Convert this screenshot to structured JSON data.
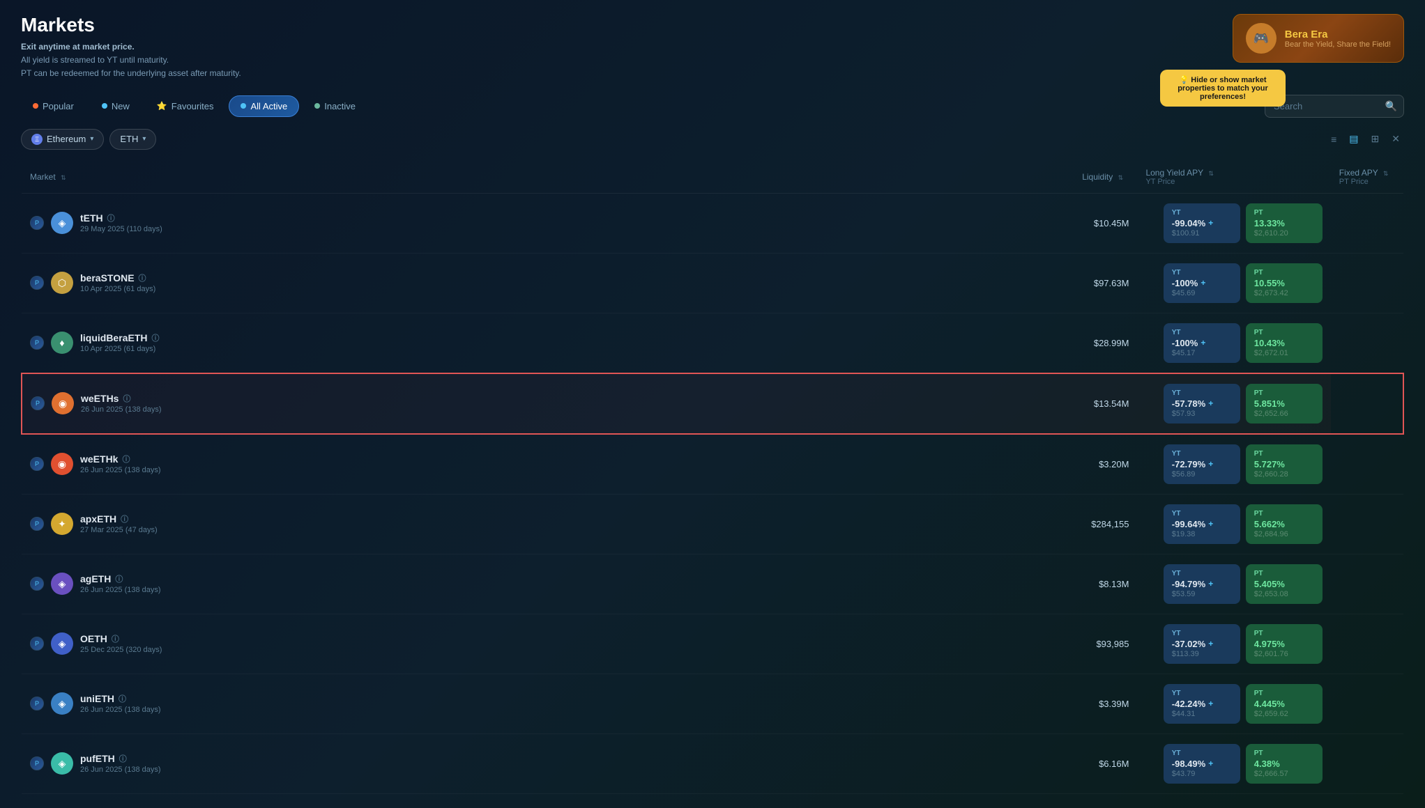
{
  "header": {
    "title": "Markets",
    "subtitle_line1": "Exit anytime at market price.",
    "subtitle_line2": "All yield is streamed to YT until maturity.",
    "subtitle_line3": "PT can be redeemed for the underlying asset after maturity."
  },
  "bera_banner": {
    "title": "Bera Era",
    "subtitle": "Bear the Yield, Share the Field!"
  },
  "tabs": [
    {
      "id": "popular",
      "label": "Popular",
      "active": false
    },
    {
      "id": "new",
      "label": "New",
      "active": false
    },
    {
      "id": "favourites",
      "label": "Favourites",
      "active": false
    },
    {
      "id": "allactive",
      "label": "All Active",
      "active": true
    },
    {
      "id": "inactive",
      "label": "Inactive",
      "active": false
    }
  ],
  "search": {
    "placeholder": "Search"
  },
  "tooltip": {
    "text": "Hide or show market properties to match your preferences!"
  },
  "filters": {
    "chain": "Ethereum",
    "asset": "ETH"
  },
  "table": {
    "columns": {
      "market": "Market",
      "liquidity": "Liquidity",
      "long_yield_apy": "Long Yield APY",
      "yt_price": "YT Price",
      "fixed_apy": "Fixed APY",
      "pt_price": "PT Price"
    },
    "rows": [
      {
        "id": "teth",
        "name": "tETH",
        "date": "29 May 2025 (110 days)",
        "liquidity": "$10.45M",
        "highlighted": false,
        "yt_value": "-99.04%",
        "yt_price": "$100.91",
        "pt_value": "13.33%",
        "pt_price": "$2,610.20",
        "icon_bg": "#4a90d9",
        "icon_text": "◈"
      },
      {
        "id": "berastone",
        "name": "beraSTONE",
        "date": "10 Apr 2025 (61 days)",
        "liquidity": "$97.63M",
        "highlighted": false,
        "yt_value": "-100%",
        "yt_price": "$45.69",
        "pt_value": "10.55%",
        "pt_price": "$2,673.42",
        "icon_bg": "#c4a040",
        "icon_text": "⬡"
      },
      {
        "id": "liquidberaETH",
        "name": "liquidBeraETH",
        "date": "10 Apr 2025 (61 days)",
        "liquidity": "$28.99M",
        "highlighted": false,
        "yt_value": "-100%",
        "yt_price": "$45.17",
        "pt_value": "10.43%",
        "pt_price": "$2,672.01",
        "icon_bg": "#3a9070",
        "icon_text": "♦"
      },
      {
        "id": "weETHs",
        "name": "weETHs",
        "date": "26 Jun 2025 (138 days)",
        "liquidity": "$13.54M",
        "highlighted": true,
        "yt_value": "-57.78%",
        "yt_price": "$57.93",
        "pt_value": "5.851%",
        "pt_price": "$2,652.66",
        "icon_bg": "#e07030",
        "icon_text": "◉"
      },
      {
        "id": "weETHk",
        "name": "weETHk",
        "date": "26 Jun 2025 (138 days)",
        "liquidity": "$3.20M",
        "highlighted": false,
        "yt_value": "-72.79%",
        "yt_price": "$56.89",
        "pt_value": "5.727%",
        "pt_price": "$2,660.28",
        "icon_bg": "#e05030",
        "icon_text": "◉"
      },
      {
        "id": "apxETH",
        "name": "apxETH",
        "date": "27 Mar 2025 (47 days)",
        "liquidity": "$284,155",
        "highlighted": false,
        "yt_value": "-99.64%",
        "yt_price": "$19.38",
        "pt_value": "5.662%",
        "pt_price": "$2,684.96",
        "icon_bg": "#d4a830",
        "icon_text": "✦"
      },
      {
        "id": "agETH",
        "name": "agETH",
        "date": "26 Jun 2025 (138 days)",
        "liquidity": "$8.13M",
        "highlighted": false,
        "yt_value": "-94.79%",
        "yt_price": "$53.59",
        "pt_value": "5.405%",
        "pt_price": "$2,653.08",
        "icon_bg": "#6a50c0",
        "icon_text": "◈"
      },
      {
        "id": "OETH",
        "name": "OETH",
        "date": "25 Dec 2025 (320 days)",
        "liquidity": "$93,985",
        "highlighted": false,
        "yt_value": "-37.02%",
        "yt_price": "$113.39",
        "pt_value": "4.975%",
        "pt_price": "$2,601.76",
        "icon_bg": "#4060c8",
        "icon_text": "◈"
      },
      {
        "id": "uniETH",
        "name": "uniETH",
        "date": "26 Jun 2025 (138 days)",
        "liquidity": "$3.39M",
        "highlighted": false,
        "yt_value": "-42.24%",
        "yt_price": "$44.31",
        "pt_value": "4.445%",
        "pt_price": "$2,659.62",
        "icon_bg": "#3a80c4",
        "icon_text": "◈"
      },
      {
        "id": "pufETH",
        "name": "pufETH",
        "date": "26 Jun 2025 (138 days)",
        "liquidity": "$6.16M",
        "highlighted": false,
        "yt_value": "-98.49%",
        "yt_price": "$43.79",
        "pt_value": "4.38%",
        "pt_price": "$2,666.57",
        "icon_bg": "#3abca8",
        "icon_text": "◈"
      }
    ]
  }
}
